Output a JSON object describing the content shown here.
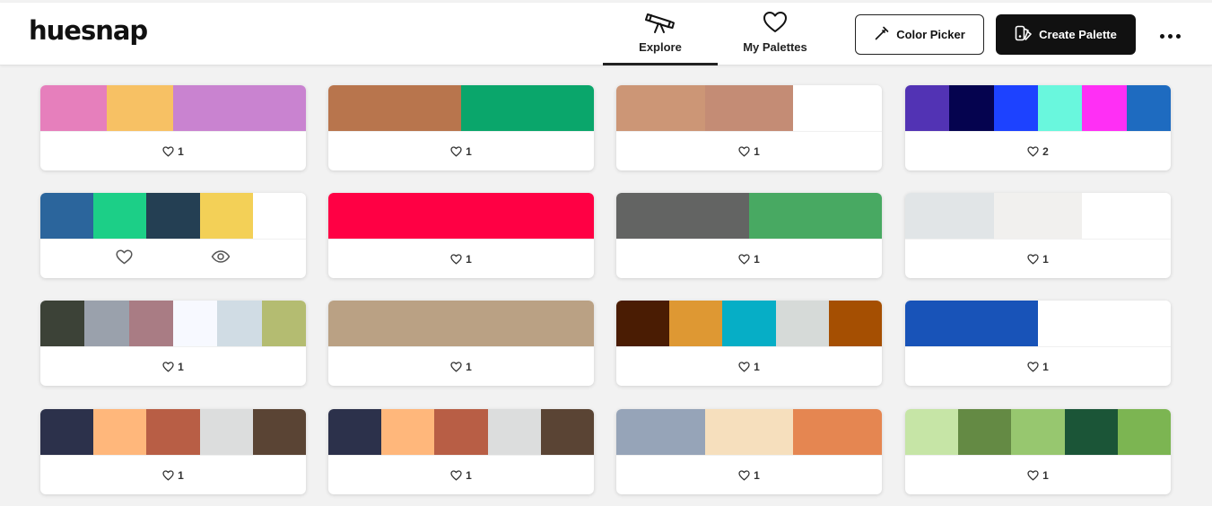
{
  "app": {
    "logo": "huesnap"
  },
  "nav": {
    "explore": {
      "label": "Explore",
      "icon": "telescope-icon"
    },
    "my_palettes": {
      "label": "My Palettes",
      "icon": "heart-icon"
    }
  },
  "actions": {
    "color_picker": {
      "label": "Color Picker",
      "icon": "eyedropper-icon"
    },
    "create_palette": {
      "label": "Create Palette",
      "icon": "palette-icon"
    },
    "more": {
      "icon": "more-dots-icon"
    }
  },
  "palettes": [
    {
      "colors": [
        "#e67fbc",
        "#f7c164",
        "#c983d0",
        "#c983d0"
      ],
      "likes": "1"
    },
    {
      "colors": [
        "#b8754d",
        "#b8754d",
        "#0aa66b",
        "#0aa66b"
      ],
      "likes": "1"
    },
    {
      "colors": [
        "#cc9676",
        "#c48c75",
        "#ffffff"
      ],
      "likes": "1"
    },
    {
      "colors": [
        "#5233b4",
        "#05034f",
        "#1d42ff",
        "#69f7dd",
        "#ff2ff5",
        "#1e6bc0"
      ],
      "likes": "2"
    },
    {
      "colors": [
        "#2b659c",
        "#1ccf87",
        "#243f53",
        "#f3d057",
        "#ffffff"
      ],
      "likes": "",
      "hover": true
    },
    {
      "colors": [
        "#ff0044",
        "#ff0044"
      ],
      "likes": "1"
    },
    {
      "colors": [
        "#636463",
        "#48a962"
      ],
      "likes": "1"
    },
    {
      "colors": [
        "#e1e5e7",
        "#f1f0ee",
        "#ffffff"
      ],
      "likes": "1"
    },
    {
      "colors": [
        "#3c4237",
        "#9aa1ac",
        "#a97c84",
        "#f7f9ff",
        "#d0dce4",
        "#b4bc71"
      ],
      "likes": "1"
    },
    {
      "colors": [
        "#baa184"
      ],
      "likes": "1"
    },
    {
      "colors": [
        "#4a1c03",
        "#de9833",
        "#06aec6",
        "#d6dad8",
        "#a54f02"
      ],
      "likes": "1"
    },
    {
      "colors": [
        "#1853b8",
        "#ffffff"
      ],
      "likes": "1"
    },
    {
      "colors": [
        "#2c314b",
        "#ffb77b",
        "#b85e45",
        "#dcdddd",
        "#5a4434"
      ],
      "likes": "1"
    },
    {
      "colors": [
        "#2c314b",
        "#ffb77b",
        "#b85e45",
        "#dcdddd",
        "#5a4434"
      ],
      "likes": "1"
    },
    {
      "colors": [
        "#96a4b8",
        "#f6dfbd",
        "#e58651"
      ],
      "likes": "1"
    },
    {
      "colors": [
        "#c6e5a6",
        "#648a44",
        "#97c76f",
        "#1b5537",
        "#7cb552"
      ],
      "likes": "1"
    }
  ]
}
